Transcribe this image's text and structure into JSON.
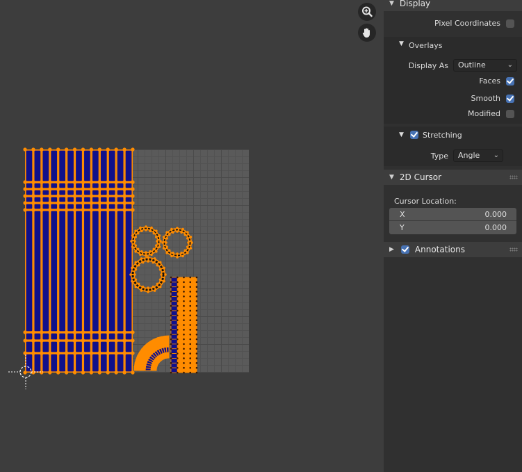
{
  "viewport": {
    "zoom_icon": "zoom-magnifier-icon",
    "pan_icon": "hand-pan-icon",
    "cursor_icon": "2d-cursor-crosshair-icon",
    "colors": {
      "uv_vertex": "#ff8c00",
      "uv_face": "#10108a",
      "grid": "#5a5a5a"
    }
  },
  "sidebar": {
    "display": {
      "header": "Display",
      "pixel_coordinates_label": "Pixel Coordinates",
      "pixel_coordinates_checked": false,
      "overlays": {
        "header": "Overlays",
        "display_as_label": "Display As",
        "display_as_value": "Outline",
        "faces_label": "Faces",
        "faces_checked": true,
        "smooth_label": "Smooth",
        "smooth_checked": true,
        "modified_label": "Modified",
        "modified_checked": false
      },
      "stretching": {
        "header": "Stretching",
        "checked": true,
        "type_label": "Type",
        "type_value": "Angle"
      }
    },
    "cursor_2d": {
      "header": "2D Cursor",
      "location_label": "Cursor Location:",
      "x_label": "X",
      "x_value": "0.000",
      "y_label": "Y",
      "y_value": "0.000"
    },
    "annotations": {
      "header": "Annotations",
      "checked": true
    }
  }
}
